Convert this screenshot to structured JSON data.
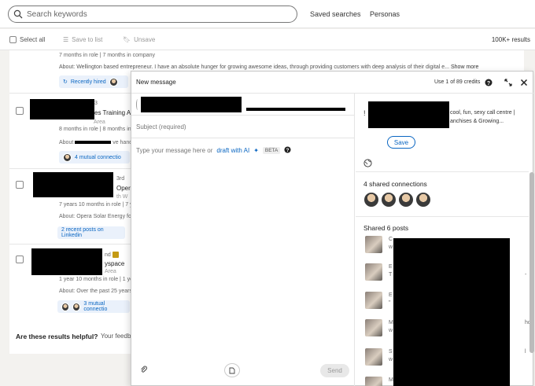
{
  "top": {
    "search_placeholder": "Search keywords",
    "saved_searches": "Saved searches",
    "personas": "Personas"
  },
  "actions": {
    "select_all": "Select all",
    "save_to_list": "Save to list",
    "unsave": "Unsave",
    "results": "100K+ results"
  },
  "rows": [
    {
      "role_line": "7 months in role | 7 months in company",
      "about_label": "About:",
      "about": "Wellington based entrepreneur. I have an absolute hunger for growing awesome ideas, through providing customers with deep analysis of their digital e...",
      "show_more": "Show more",
      "pill": "Recently hired"
    },
    {
      "degree": "3",
      "title_frag": "es Training A",
      "loc": "Area",
      "role_line": "8 months in role | 8 months in",
      "about_label": "About",
      "about_frag": "ve hand",
      "pill": "4 mutual connectio"
    },
    {
      "degree": "3rd",
      "title_frag": "Opera",
      "loc": "th W",
      "role_line": "7 years 10 months in role | 7 y",
      "about_label": "About:",
      "about": "Opera Solar Energy fou",
      "pill": "2 recent posts on Linkedin"
    },
    {
      "degree": "nd",
      "title_frag": "yspace",
      "loc": "Area",
      "role_line": "1 year 10 months in role | 1 ye",
      "about_label": "About:",
      "about": "Over the past 25 years,",
      "pill": "3 mutual connectio"
    }
  ],
  "helpful": {
    "question": "Are these results helpful?",
    "feedback": "Your feedb"
  },
  "modal": {
    "title": "New message",
    "credits": "Use 1 of 89 credits",
    "subject_placeholder": "Subject (required)",
    "body_placeholder": "Type your message here or",
    "draft_ai": "draft with AI",
    "beta": "BETA",
    "send": "Send",
    "profile_text_line1": "cool, fun, sexy call centre |",
    "profile_text_line2": "anchises & Growing...",
    "save": "Save",
    "shared_connections": "4 shared connections",
    "shared_posts": "Shared 6 posts",
    "post_letters": [
      "C",
      "E",
      "E",
      "M",
      "S",
      "M"
    ],
    "post_letters2": [
      "w",
      "T",
      "\"",
      "w",
      "w",
      ""
    ],
    "post_right": [
      "",
      "-",
      "",
      "ho",
      "l",
      ""
    ],
    "accent": "#0a66c2"
  }
}
